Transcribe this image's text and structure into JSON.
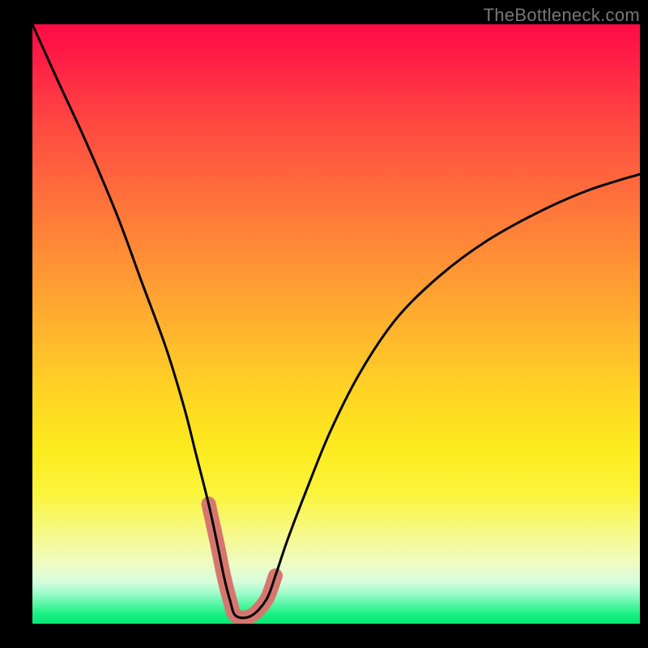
{
  "watermark": "TheBottleneck.com",
  "chart_data": {
    "type": "line",
    "title": "",
    "xlabel": "",
    "ylabel": "",
    "xlim": [
      0,
      100
    ],
    "ylim": [
      0,
      100
    ],
    "x": [
      0,
      4,
      9,
      14,
      18,
      22,
      25,
      27,
      29,
      30.5,
      31.5,
      32.5,
      33.5,
      36,
      38.5,
      40,
      42,
      45,
      49,
      54,
      60,
      67,
      75,
      84,
      92,
      100
    ],
    "values": [
      100,
      91,
      80,
      68,
      57,
      46,
      36,
      28,
      20,
      13,
      8,
      4,
      1.3,
      1.3,
      4,
      8,
      14,
      22,
      32,
      42,
      51,
      58,
      64,
      69,
      72.5,
      75
    ],
    "highlight_region": {
      "x_start": 27,
      "x_end": 40,
      "y_min": 1.3,
      "y_max": 20,
      "color": "#d6776f"
    },
    "background_gradient": [
      {
        "stop": 0,
        "color": "#ff0a46"
      },
      {
        "stop": 50,
        "color": "#ffb12e"
      },
      {
        "stop": 78,
        "color": "#fbf43a"
      },
      {
        "stop": 100,
        "color": "#07e874"
      }
    ]
  }
}
